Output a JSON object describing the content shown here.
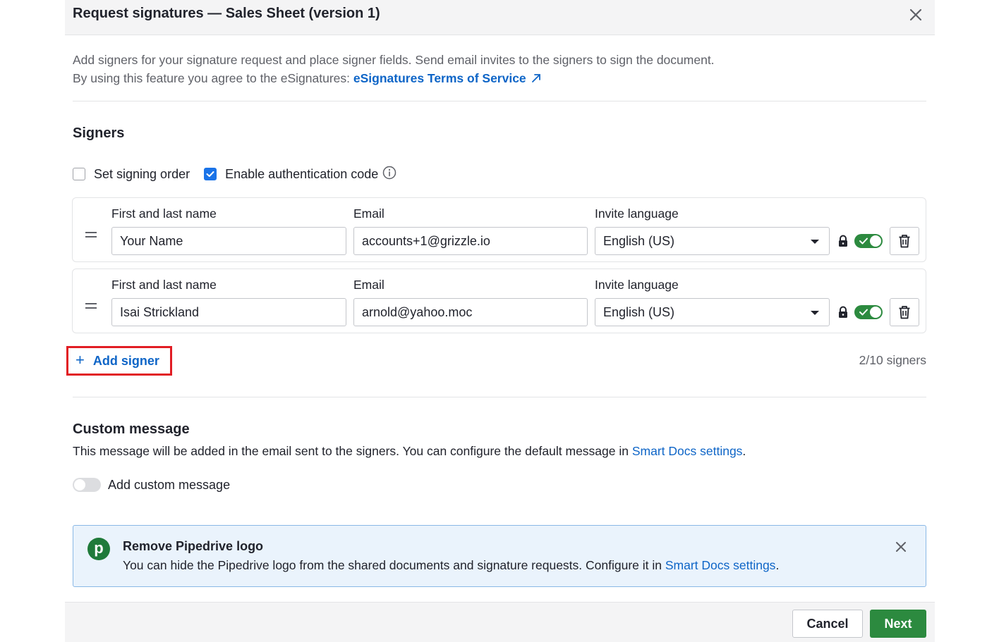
{
  "header": {
    "title": "Request signatures — Sales Sheet (version 1)"
  },
  "intro": {
    "line1": "Add signers for your signature request and place signer fields. Send email invites to the signers to sign the document.",
    "line2_prefix": "By using this feature you agree to the eSignatures: ",
    "tos_link": "eSignatures Terms of Service"
  },
  "signers": {
    "title": "Signers",
    "set_signing_order": {
      "label": "Set signing order",
      "checked": false
    },
    "enable_auth_code": {
      "label": "Enable authentication code",
      "checked": true
    },
    "labels": {
      "name": "First and last name",
      "email": "Email",
      "language": "Invite language"
    },
    "rows": [
      {
        "name": "Your Name",
        "email": "accounts+1@grizzle.io",
        "language": "English (US)",
        "auth_enabled": true
      },
      {
        "name": "Isai Strickland",
        "email": "arnold@yahoo.moc",
        "language": "English (US)",
        "auth_enabled": true
      }
    ],
    "add_signer_label": "Add signer",
    "count": "2/10 signers"
  },
  "custom_message": {
    "title": "Custom message",
    "desc_prefix": "This message will be added in the email sent to the signers. You can configure the default message in ",
    "settings_link": "Smart Docs settings",
    "desc_suffix": ".",
    "toggle_label": "Add custom message",
    "enabled": false
  },
  "banner": {
    "logo_letter": "p",
    "title": "Remove Pipedrive logo",
    "text_prefix": "You can hide the Pipedrive logo from the shared documents and signature requests. Configure it in ",
    "settings_link": "Smart Docs settings",
    "text_suffix": "."
  },
  "footer": {
    "cancel": "Cancel",
    "next": "Next"
  },
  "colors": {
    "accent": "#0e65c7",
    "primary_green": "#2c8a3f",
    "highlight_red": "#e11d24"
  }
}
